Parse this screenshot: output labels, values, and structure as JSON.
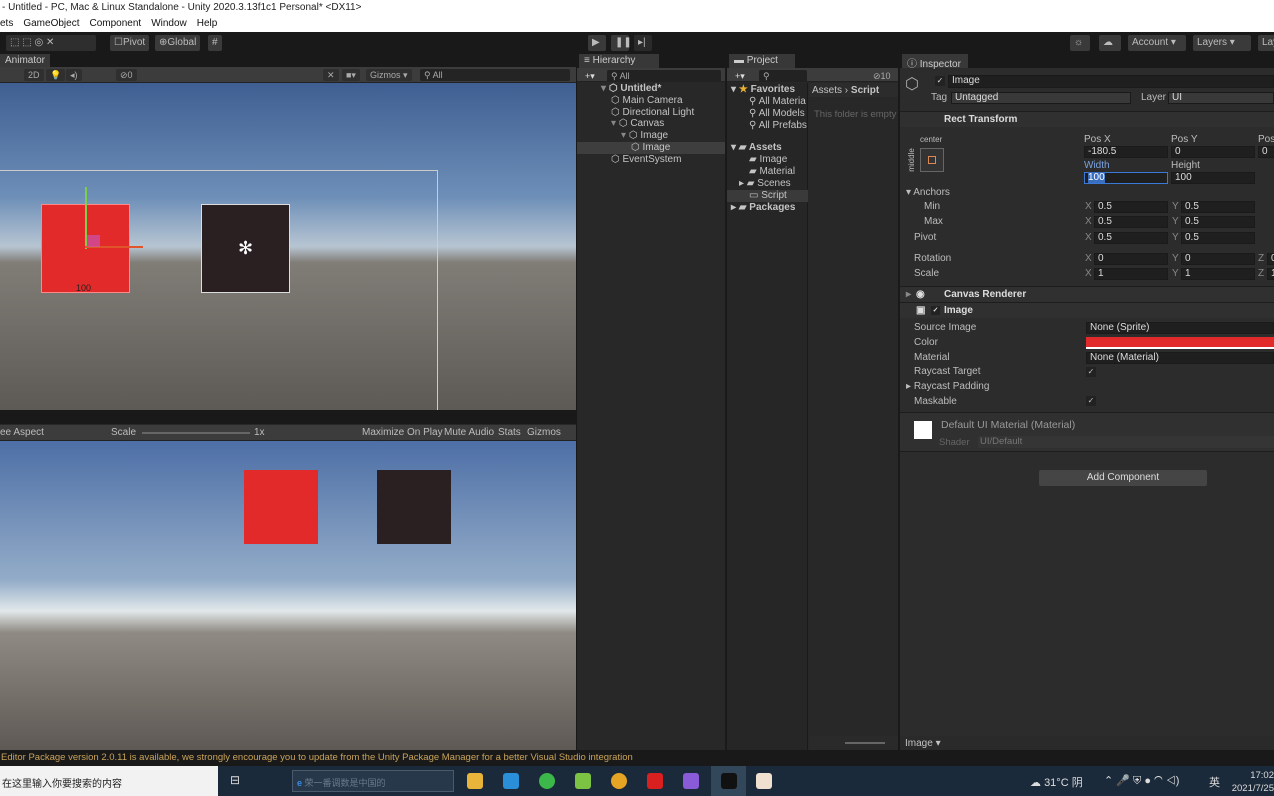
{
  "window": {
    "title": "- Untitled - PC, Mac & Linux Standalone - Unity 2020.3.13f1c1 Personal* <DX11>"
  },
  "menu": [
    "ets",
    "GameObject",
    "Component",
    "Window",
    "Help"
  ],
  "toolbar": {
    "pivot": "Pivot",
    "global": "Global",
    "account": "Account",
    "layers": "Layers",
    "layout": "Lay"
  },
  "scene": {
    "tab": "Animator",
    "mode2d": "2D",
    "hidden_count": "0",
    "gizmos": "Gizmos",
    "search_placeholder": "All",
    "size_label": "100"
  },
  "game": {
    "aspect": "ee Aspect",
    "scale_label": "Scale",
    "scale_value": "1x",
    "maximize": "Maximize On Play",
    "mute": "Mute Audio",
    "stats": "Stats",
    "gizmos": "Gizmos"
  },
  "hierarchy": {
    "tab": "Hierarchy",
    "search_placeholder": "All",
    "items": [
      {
        "label": "Untitled*",
        "depth": 0,
        "expanded": true,
        "bold": true
      },
      {
        "label": "Main Camera",
        "depth": 1
      },
      {
        "label": "Directional Light",
        "depth": 1
      },
      {
        "label": "Canvas",
        "depth": 1,
        "expanded": true
      },
      {
        "label": "Image",
        "depth": 2,
        "expanded": true
      },
      {
        "label": "Image",
        "depth": 3,
        "selected": true
      },
      {
        "label": "EventSystem",
        "depth": 1
      }
    ]
  },
  "project": {
    "tab": "Project",
    "hidden_count": "10",
    "breadcrumb": [
      "Assets",
      "Script"
    ],
    "empty_msg": "This folder is empty",
    "favorites": {
      "label": "Favorites",
      "items": [
        "All Materia",
        "All Models",
        "All Prefabs"
      ]
    },
    "assets": {
      "label": "Assets",
      "items": [
        "Image",
        "Material",
        "Scenes",
        "Script"
      ]
    },
    "packages": "Packages",
    "footer_label": "Image"
  },
  "inspector": {
    "tab": "Inspector",
    "object_name": "Image",
    "tag_label": "Tag",
    "tag": "Untagged",
    "layer_label": "Layer",
    "layer": "UI",
    "rect_transform": {
      "title": "Rect Transform",
      "anchor_h": "center",
      "anchor_v": "middle",
      "pos_x_label": "Pos X",
      "pos_y_label": "Pos Y",
      "pos_z_label": "Pos",
      "pos_x": "-180.5",
      "pos_y": "0",
      "pos_z": "0",
      "width_label": "Width",
      "height_label": "Height",
      "width": "100",
      "height": "100",
      "anchors": "Anchors",
      "min": "Min",
      "max": "Max",
      "pivot": "Pivot",
      "rotation": "Rotation",
      "scale": "Scale",
      "min_x": "0.5",
      "min_y": "0.5",
      "max_x": "0.5",
      "max_y": "0.5",
      "pivot_x": "0.5",
      "pivot_y": "0.5",
      "rot_x": "0",
      "rot_y": "0",
      "rot_z": "0",
      "scale_x": "1",
      "scale_y": "1",
      "scale_z": "1",
      "x": "X",
      "y": "Y",
      "z": "Z"
    },
    "canvas_renderer": "Canvas Renderer",
    "image": {
      "title": "Image",
      "source_image_label": "Source Image",
      "source_image": "None (Sprite)",
      "color_label": "Color",
      "color": "#e32a2a",
      "material_label": "Material",
      "material": "None (Material)",
      "raycast_target": "Raycast Target",
      "raycast_padding": "Raycast Padding",
      "maskable": "Maskable"
    },
    "material": {
      "name": "Default UI Material (Material)",
      "shader_label": "Shader",
      "shader": "UI/Default"
    },
    "add_component": "Add Component"
  },
  "status": "Editor Package version 2.0.11 is available, we strongly encourage you to update from the Unity Package Manager for a better Visual Studio integration",
  "taskbar": {
    "search": "在这里输入你要搜索的内容",
    "browser_search": "荣一番调数是中国的",
    "weather": "31°C 阴",
    "ime": "英",
    "time": "17:02",
    "date": "2021/7/25"
  }
}
